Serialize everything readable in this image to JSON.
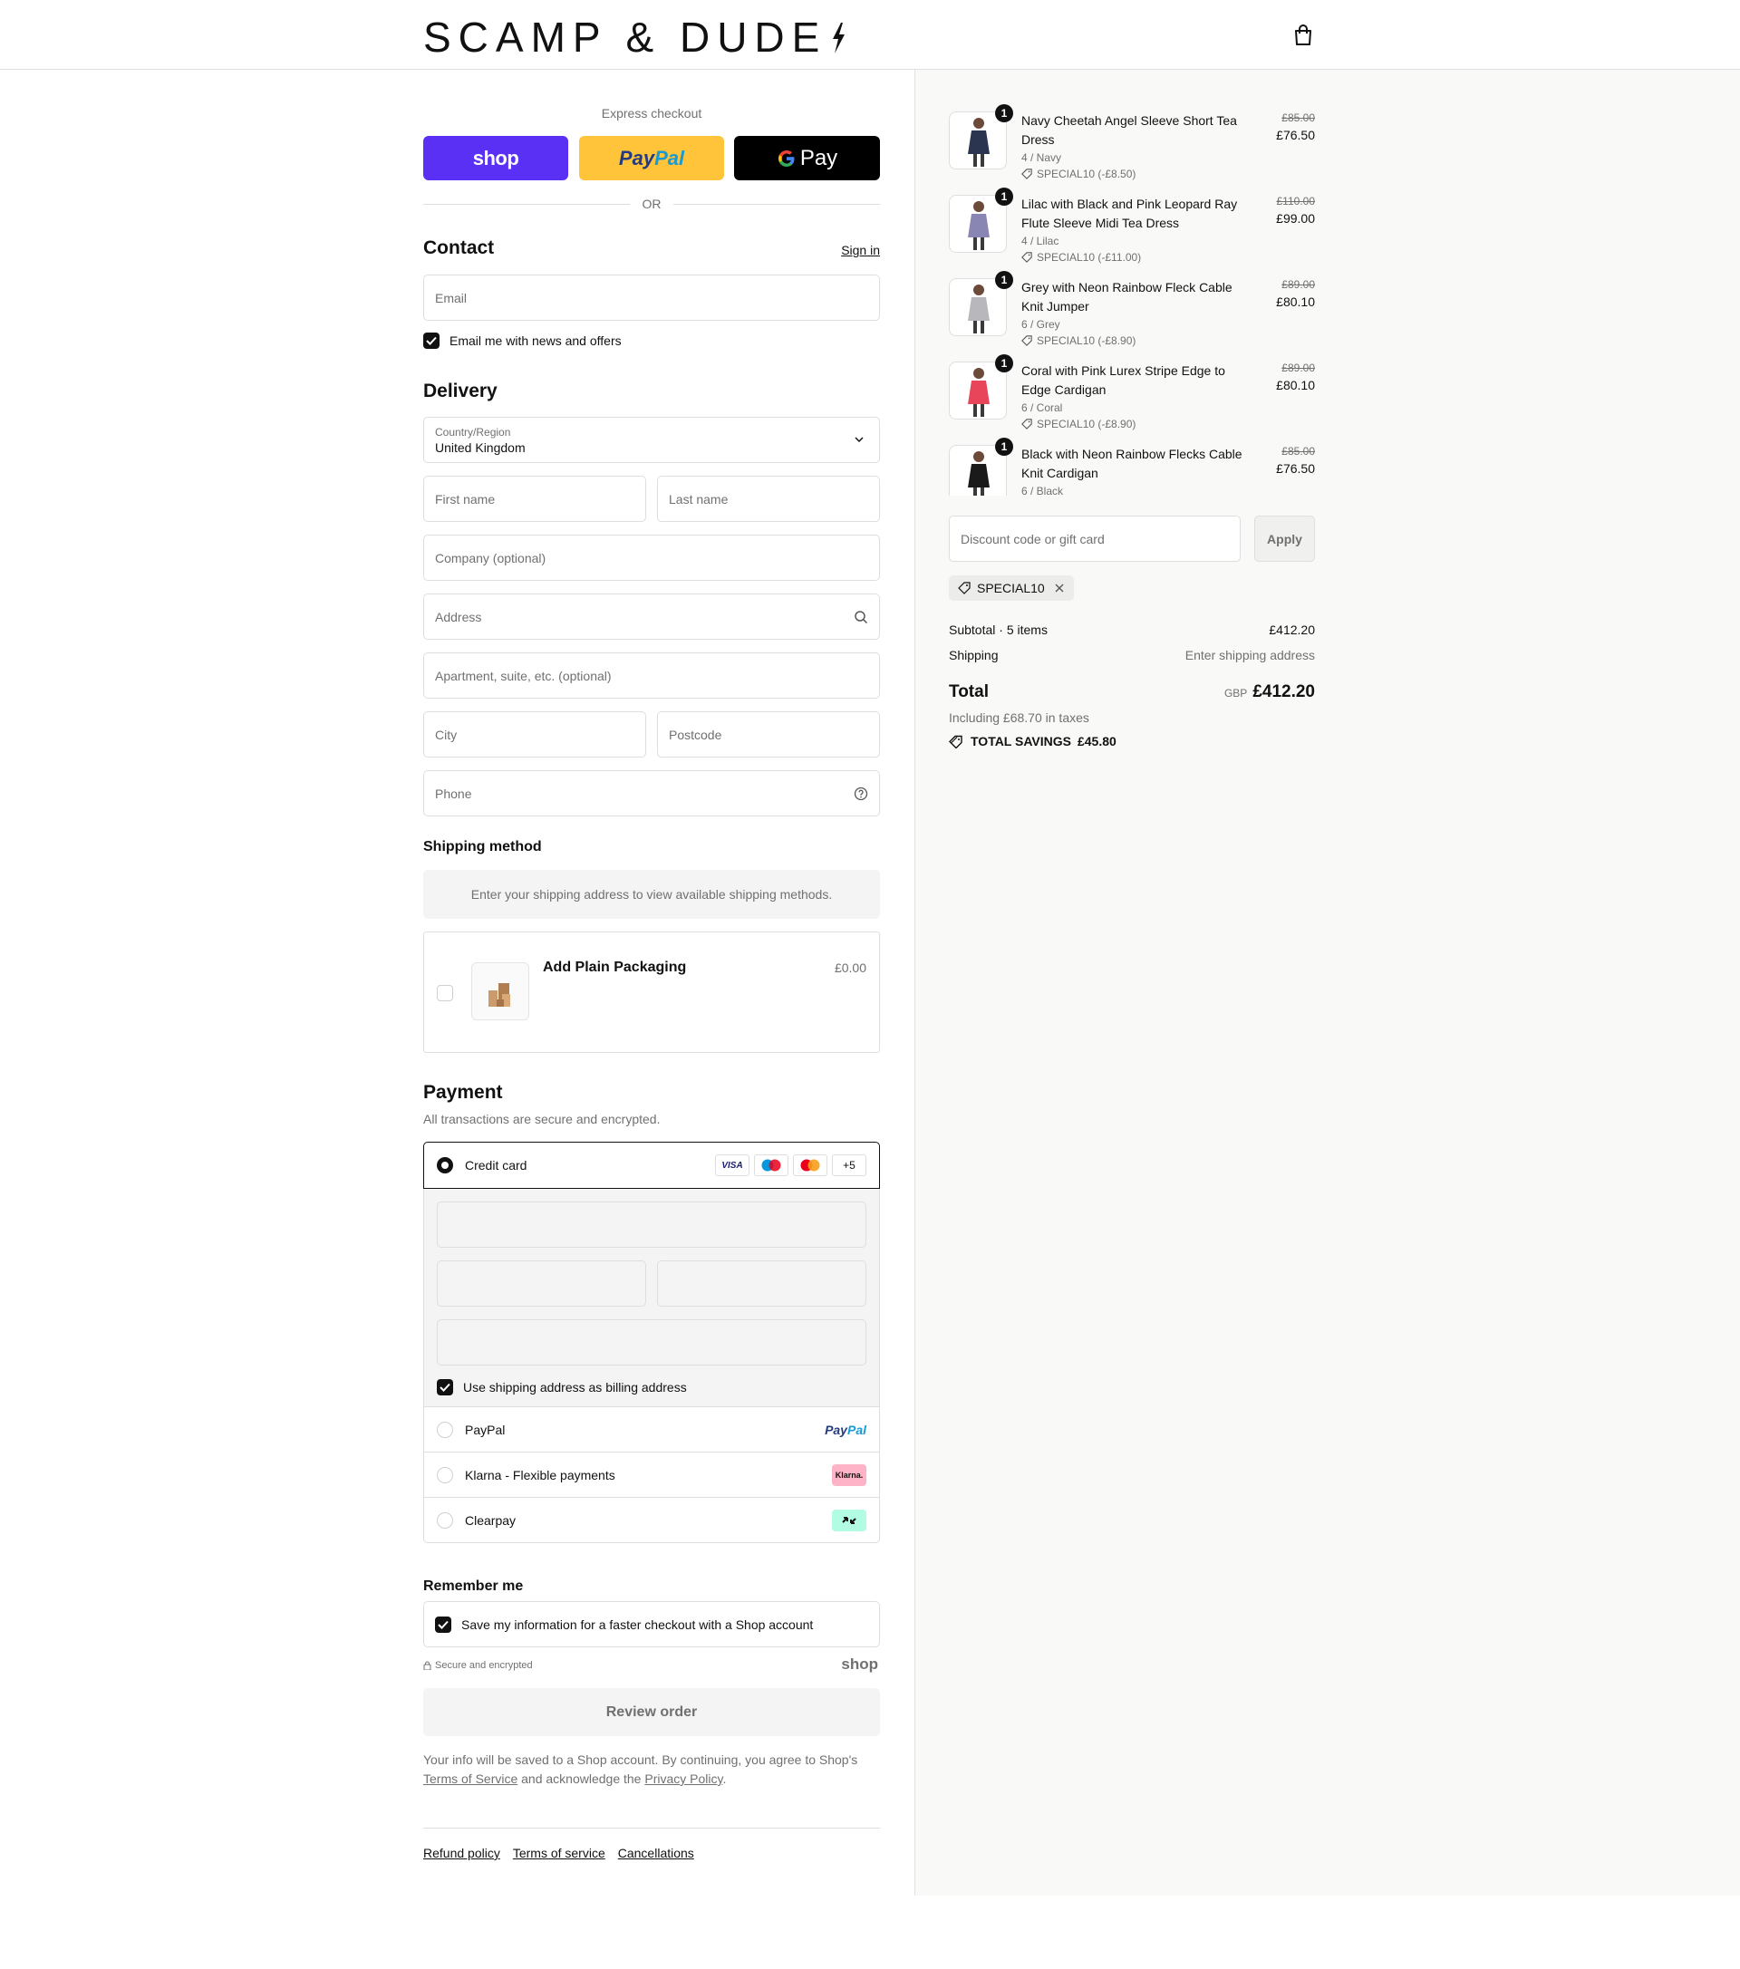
{
  "brand": {
    "name": "SCAMP & DUDE"
  },
  "express": {
    "label": "Express checkout",
    "shop_label": "shop",
    "paypal_a": "Pay",
    "paypal_b": "Pal",
    "gpay_label": "Pay",
    "or_label": "OR"
  },
  "contact": {
    "title": "Contact",
    "sign_in": "Sign in",
    "email_placeholder": "Email",
    "news_label": "Email me with news and offers",
    "news_checked": true
  },
  "delivery": {
    "title": "Delivery",
    "country_label": "Country/Region",
    "country_value": "United Kingdom",
    "first_name": "First name",
    "last_name": "Last name",
    "company": "Company (optional)",
    "address": "Address",
    "apartment": "Apartment, suite, etc. (optional)",
    "city": "City",
    "postcode": "Postcode",
    "phone": "Phone"
  },
  "shipping": {
    "title": "Shipping method",
    "info": "Enter your shipping address to view available shipping methods."
  },
  "packaging": {
    "name": "Add Plain Packaging",
    "price": "£0.00",
    "checked": false
  },
  "payment": {
    "title": "Payment",
    "subtitle": "All transactions are secure and encrypted.",
    "credit_card": "Credit card",
    "card_visa": "VISA",
    "card_more": "+5",
    "billing_label": "Use shipping address as billing address",
    "paypal": "PayPal",
    "paypal_logo_a": "Pay",
    "paypal_logo_b": "Pal",
    "klarna": "Klarna - Flexible payments",
    "klarna_logo": "Klarna.",
    "clearpay": "Clearpay"
  },
  "remember": {
    "title": "Remember me",
    "save_label": "Save my information for a faster checkout with a Shop account",
    "secure": "Secure and encrypted",
    "shop_logo": "shop"
  },
  "review": {
    "button": "Review order",
    "notice_a": "Your info will be saved to a Shop account. By continuing, you agree to Shop's",
    "terms_link": "Terms of Service",
    "notice_b": "and acknowledge the",
    "privacy_link": "Privacy Policy",
    "notice_c": "."
  },
  "footer": {
    "refund": "Refund policy",
    "terms": "Terms of service",
    "cancellations": "Cancellations"
  },
  "cart": {
    "items": [
      {
        "qty": "1",
        "name": "Navy Cheetah Angel Sleeve Short Tea Dress",
        "variant": "4 / Navy",
        "discount": "SPECIAL10 (-£8.50)",
        "old_price": "£85.00",
        "price": "£76.50",
        "color": "#2c3550"
      },
      {
        "qty": "1",
        "name": "Lilac with Black and Pink Leopard Ray Flute Sleeve Midi Tea Dress",
        "variant": "4 / Lilac",
        "discount": "SPECIAL10 (-£11.00)",
        "old_price": "£110.00",
        "price": "£99.00",
        "color": "#8a86b3"
      },
      {
        "qty": "1",
        "name": "Grey with Neon Rainbow Fleck Cable Knit Jumper",
        "variant": "6 / Grey",
        "discount": "SPECIAL10 (-£8.90)",
        "old_price": "£89.00",
        "price": "£80.10",
        "color": "#b8b8bc"
      },
      {
        "qty": "1",
        "name": "Coral with Pink Lurex Stripe Edge to Edge Cardigan",
        "variant": "6 / Coral",
        "discount": "SPECIAL10 (-£8.90)",
        "old_price": "£89.00",
        "price": "£80.10",
        "color": "#e8455a"
      },
      {
        "qty": "1",
        "name": "Black with Neon Rainbow Flecks Cable Knit Cardigan",
        "variant": "6 / Black",
        "discount": "",
        "old_price": "£85.00",
        "price": "£76.50",
        "color": "#1a1a1a"
      }
    ]
  },
  "discount": {
    "placeholder": "Discount code or gift card",
    "apply": "Apply",
    "tag": "SPECIAL10"
  },
  "summary": {
    "subtotal_label": "Subtotal · 5 items",
    "subtotal_value": "£412.20",
    "shipping_label": "Shipping",
    "shipping_value": "Enter shipping address",
    "total_label": "Total",
    "currency": "GBP",
    "total_value": "£412.20",
    "taxes": "Including £68.70 in taxes",
    "savings_label": "TOTAL SAVINGS",
    "savings_value": "£45.80"
  },
  "colors": {
    "shop_purple": "#5a31f4",
    "paypal_yellow": "#ffc439",
    "klarna_pink": "#ffb3c7",
    "clearpay_mint": "#b2fce4"
  }
}
